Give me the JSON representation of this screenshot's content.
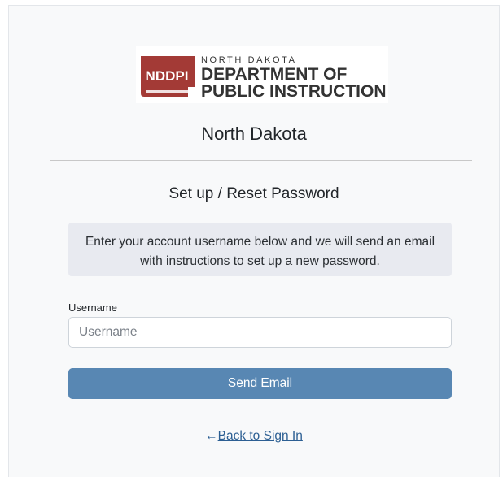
{
  "logo": {
    "abbr": "NDDPI",
    "line1": "NORTH DAKOTA",
    "line2": "DEPARTMENT OF",
    "line3": "PUBLIC INSTRUCTION",
    "brand_color": "#a33a36"
  },
  "org_title": "North Dakota",
  "page_title": "Set up / Reset Password",
  "notice": "Enter your account username below and we will send an email with instructions to set up a new password.",
  "form": {
    "username_label": "Username",
    "username_placeholder": "Username",
    "username_value": "",
    "send_button": "Send Email"
  },
  "back_link": {
    "arrow": "←",
    "label": "Back to Sign In"
  },
  "colors": {
    "button": "#5887b3",
    "link": "#2c5f93",
    "notice_bg": "#e8eaf0"
  }
}
